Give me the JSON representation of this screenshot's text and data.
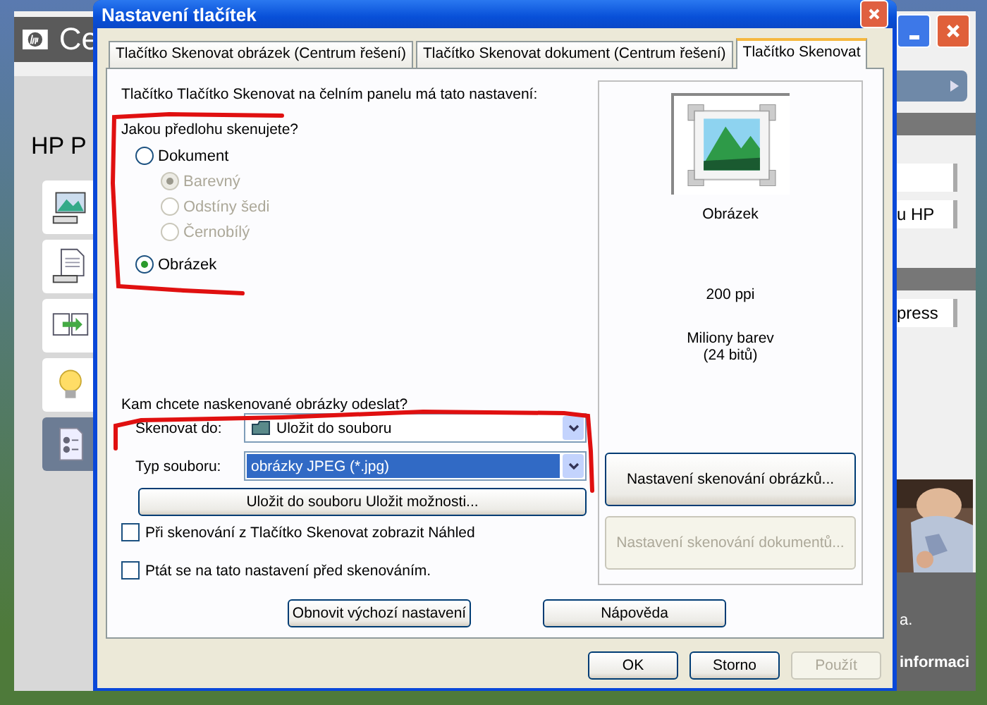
{
  "background_app": {
    "title": "Ce",
    "heading": "HP P",
    "right_items": [
      "u HP",
      "press"
    ],
    "footer_texts": [
      "a.",
      "informaci"
    ]
  },
  "dialog": {
    "title": "Nastavení tlačítek",
    "tabs": [
      {
        "label": "Tlačítko Skenovat obrázek (Centrum řešení)",
        "selected": false
      },
      {
        "label": "Tlačítko Skenovat dokument (Centrum řešení)",
        "selected": false
      },
      {
        "label": "Tlačítko Skenovat",
        "selected": true
      }
    ],
    "intro": "Tlačítko Tlačítko Skenovat na čelním panelu má tato nastavení:",
    "question": "Jakou předlohu skenujete?",
    "source_options": [
      {
        "label": "Dokument",
        "selected": false,
        "disabled": false,
        "children": [
          {
            "label": "Barevný",
            "selected": true,
            "disabled": true
          },
          {
            "label": "Odstíny šedi",
            "selected": false,
            "disabled": true
          },
          {
            "label": "Černobílý",
            "selected": false,
            "disabled": true
          }
        ]
      },
      {
        "label": "Obrázek",
        "selected": true,
        "disabled": false
      }
    ],
    "preview": {
      "caption": "Obrázek",
      "resolution": "200 ppi",
      "color_depth": "Miliony barev",
      "bits": "(24 bitů)"
    },
    "destination_question": "Kam chcete naskenované obrázky odeslat?",
    "fields": [
      {
        "label": "Skenovat do:",
        "value": "Uložit do souboru",
        "icon": true,
        "highlighted": false
      },
      {
        "label": "Typ souboru:",
        "value": "obrázky JPEG (*.jpg)",
        "icon": false,
        "highlighted": true
      }
    ],
    "save_options_button": "Uložit do souboru Uložit možnosti...",
    "checkboxes": [
      {
        "label": "Při skenování z Tlačítko Skenovat zobrazit Náhled",
        "checked": false
      },
      {
        "label": "Ptát se na tato nastavení před skenováním.",
        "checked": false
      }
    ],
    "side_buttons": [
      {
        "label": "Nastavení skenování obrázků...",
        "disabled": false
      },
      {
        "label": "Nastavení skenování dokumentů...",
        "disabled": true
      }
    ],
    "panel_buttons": [
      "Obnovit výchozí nastavení",
      "Nápověda"
    ],
    "footer_buttons": [
      {
        "label": "OK",
        "disabled": false
      },
      {
        "label": "Storno",
        "disabled": false
      },
      {
        "label": "Použít",
        "disabled": true
      }
    ]
  }
}
